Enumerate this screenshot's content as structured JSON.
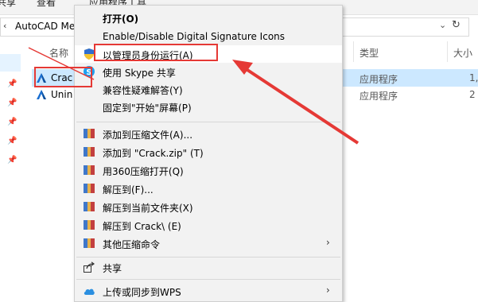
{
  "ribbon": {
    "tabs": [
      "共享",
      "查看",
      "应用程序工具"
    ]
  },
  "address": {
    "path": "AutoCAD Me"
  },
  "columns": {
    "name": "名称",
    "type": "类型",
    "size": "大小"
  },
  "files": [
    {
      "name": "Crac",
      "type": "应用程序",
      "size": "1,3",
      "icon": "autocad-icon"
    },
    {
      "name": "Unin",
      "type": "应用程序",
      "size": "2",
      "icon": "autocad-icon"
    }
  ],
  "context_menu": {
    "items": [
      {
        "label": "打开(O)",
        "icon": ""
      },
      {
        "label": "Enable/Disable Digital Signature Icons",
        "icon": ""
      },
      {
        "label": "以管理员身份运行(A)",
        "icon": "uac-shield-icon"
      },
      {
        "label": "使用 Skype 共享",
        "icon": "skype-icon"
      },
      {
        "label": "兼容性疑难解答(Y)",
        "icon": ""
      },
      {
        "label": "固定到\"开始\"屏幕(P)",
        "icon": ""
      },
      {
        "label": "添加到压缩文件(A)...",
        "icon": "archive-icon"
      },
      {
        "label": "添加到 \"Crack.zip\" (T)",
        "icon": "archive-icon"
      },
      {
        "label": "用360压缩打开(Q)",
        "icon": "archive-icon"
      },
      {
        "label": "解压到(F)...",
        "icon": "archive-icon"
      },
      {
        "label": "解压到当前文件夹(X)",
        "icon": "archive-icon"
      },
      {
        "label": "解压到 Crack\\ (E)",
        "icon": "archive-icon"
      },
      {
        "label": "其他压缩命令",
        "icon": "archive-icon"
      },
      {
        "label": "共享",
        "icon": "share-icon"
      },
      {
        "label": "上传或同步到WPS",
        "icon": "cloud-icon"
      }
    ]
  },
  "colors": {
    "annotation": "#e53935",
    "selection": "#cce8ff"
  }
}
